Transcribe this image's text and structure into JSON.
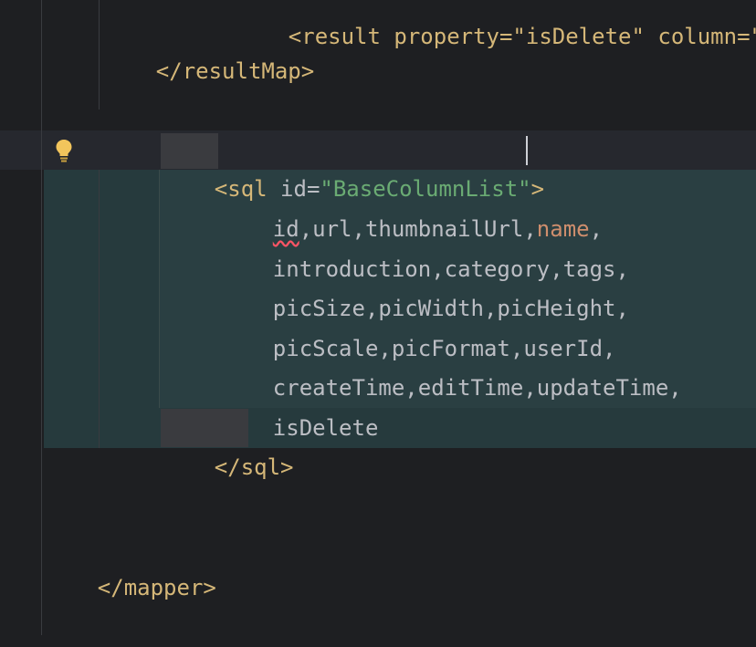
{
  "editor": {
    "partial_top_line": "<result property=\"isDelete\" column=\"i",
    "lines": {
      "result_map_close": "</resultMap>",
      "sql_open_tag": "<sql",
      "sql_attr_name": "id",
      "sql_eq": "=",
      "sql_attr_value": "\"BaseColumnList\"",
      "sql_gt": ">",
      "col_line1_id": "id",
      "col_line1_rest": ",url,thumbnailUrl,",
      "col_line1_name": "name",
      "col_line1_comma": ",",
      "col_line2": "introduction,category,tags,",
      "col_line3": "picSize,picWidth,picHeight,",
      "col_line4": "picScale,picFormat,userId,",
      "col_line5": "createTime,editTime,updateTime,",
      "col_line6": "isDelete",
      "sql_close": "</sql>",
      "mapper_close": "</mapper>"
    },
    "gutter_icon": "lightbulb-icon",
    "colors": {
      "background": "#1e1f22",
      "tag": "#d5b778",
      "string": "#6aab73",
      "keyword": "#cf8e6d",
      "text": "#bcbec4",
      "selection": "#263a3d"
    }
  }
}
